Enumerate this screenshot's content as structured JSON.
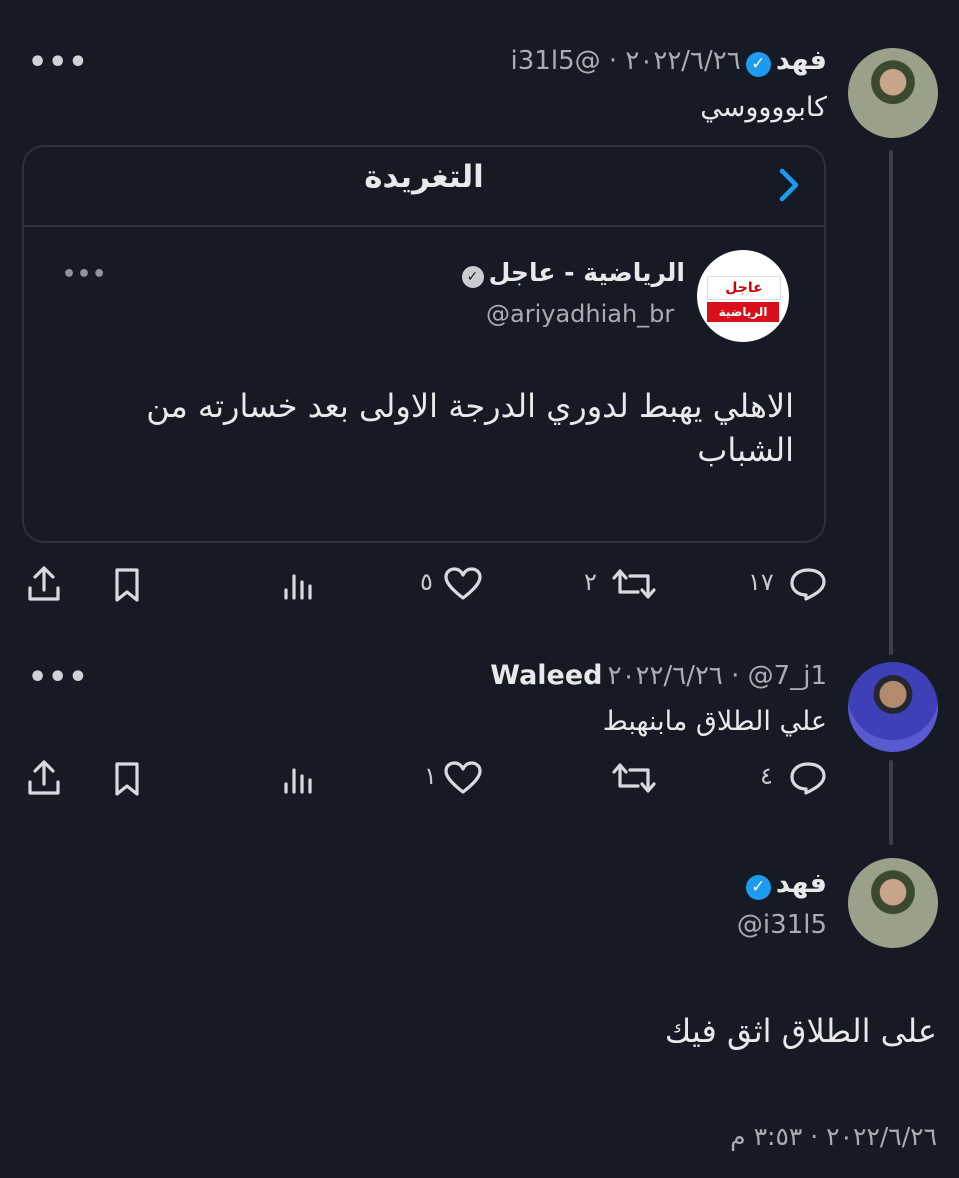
{
  "tweet1": {
    "name": "فهد",
    "meta": "٢٠٢٢/٦/٢٦ · @i31l5",
    "text": "كابووووسي",
    "actions": {
      "replies": "١٧",
      "retweets": "٢",
      "likes": "٥"
    }
  },
  "quote": {
    "header": "التغريدة",
    "name": "الرياضية - عاجل",
    "handle": "@ariyadhiah_br",
    "logo_top": "عاجل",
    "logo_bottom": "الرياضية",
    "text": "الاهلي يهبط لدوري الدرجة الاولى بعد خسارته من الشباب"
  },
  "tweet2": {
    "name": "Waleed",
    "meta": "٢٠٢٢/٦/٢٦ · @7_j1",
    "text": "علي الطلاق مابنهبط",
    "actions": {
      "replies": "٤",
      "retweets": "",
      "likes": "١"
    }
  },
  "tweet3": {
    "name": "فهد",
    "handle": "@i31l5",
    "text": "على الطلاق اثق فيك",
    "timestamp": "٢٠٢٢/٦/٢٦ · ٣:٥٣ م"
  },
  "more_label": "•••",
  "colors": {
    "background": "#161a24",
    "verified": "#1d9bf0",
    "chevron": "#1d9bf0"
  },
  "icons": [
    "more-icon",
    "verified-icon",
    "back-chevron-icon",
    "reply-icon",
    "retweet-icon",
    "like-icon",
    "views-icon",
    "bookmark-icon",
    "share-icon"
  ]
}
